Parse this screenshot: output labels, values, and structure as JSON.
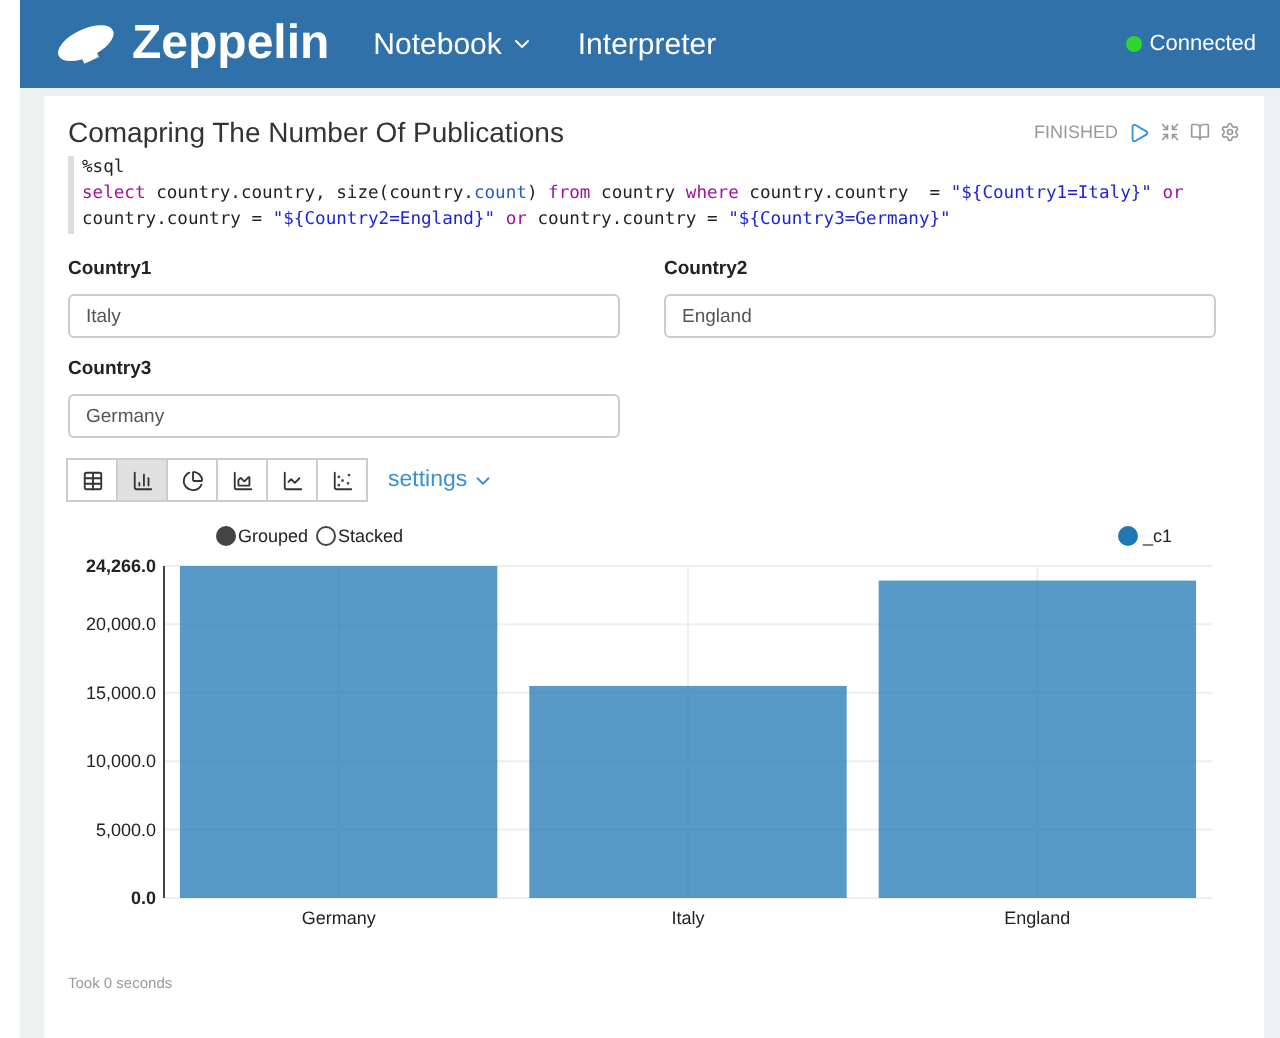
{
  "navbar": {
    "brand": "Zeppelin",
    "menu": [
      {
        "label": "Notebook",
        "dropdown": true
      },
      {
        "label": "Interpreter",
        "dropdown": false
      }
    ],
    "status": {
      "label": "Connected",
      "color": "#2fd52f"
    }
  },
  "paragraph": {
    "title": "Comapring The Number Of Publications",
    "status": "FINISHED",
    "code": [
      [
        {
          "kind": "plain",
          "text": "%sql"
        }
      ],
      [
        {
          "kind": "keyword",
          "text": "select"
        },
        {
          "kind": "plain",
          "text": " country.country, size(country."
        },
        {
          "kind": "builtin",
          "text": "count"
        },
        {
          "kind": "plain",
          "text": ") "
        },
        {
          "kind": "keyword",
          "text": "from"
        },
        {
          "kind": "plain",
          "text": " country "
        },
        {
          "kind": "keyword",
          "text": "where"
        },
        {
          "kind": "plain",
          "text": " country.country  = "
        },
        {
          "kind": "string",
          "text": "\"${Country1=Italy}\" "
        },
        {
          "kind": "keyword",
          "text": "or"
        }
      ],
      [
        {
          "kind": "plain",
          "text": "country.country = "
        },
        {
          "kind": "string",
          "text": "\"${Country2=England}\" "
        },
        {
          "kind": "keyword",
          "text": "or"
        },
        {
          "kind": "plain",
          "text": " country.country = "
        },
        {
          "kind": "string",
          "text": "\"${Country3=Germany}\""
        }
      ]
    ],
    "form": [
      {
        "label": "Country1",
        "value": "Italy"
      },
      {
        "label": "Country2",
        "value": "England"
      },
      {
        "label": "Country3",
        "value": "Germany"
      }
    ],
    "chart_types": [
      {
        "kind": "table",
        "selected": false
      },
      {
        "kind": "bar",
        "selected": true
      },
      {
        "kind": "pie",
        "selected": false
      },
      {
        "kind": "area",
        "selected": false
      },
      {
        "kind": "line",
        "selected": false
      },
      {
        "kind": "scatter",
        "selected": false
      }
    ],
    "settings": "settings",
    "modes": [
      {
        "label": "Grouped",
        "selected": true
      },
      {
        "label": "Stacked",
        "selected": false
      }
    ],
    "chart_data": {
      "type": "bar",
      "categories": [
        "Germany",
        "Italy",
        "England"
      ],
      "series": [
        {
          "name": "_c1",
          "color": "#1f77b4",
          "values": [
            24266,
            15500,
            23200
          ]
        }
      ],
      "grid": true,
      "ylim": [
        0,
        24266
      ],
      "yticks": [
        {
          "value": 0,
          "label": "0.0"
        },
        {
          "value": 5000,
          "label": "5,000.0"
        },
        {
          "value": 10000,
          "label": "10,000.0"
        },
        {
          "value": 15000,
          "label": "15,000.0"
        },
        {
          "value": 20000,
          "label": "20,000.0"
        },
        {
          "value": 24266,
          "label": "24,266.0"
        }
      ]
    },
    "footer": "Took 0 seconds"
  }
}
